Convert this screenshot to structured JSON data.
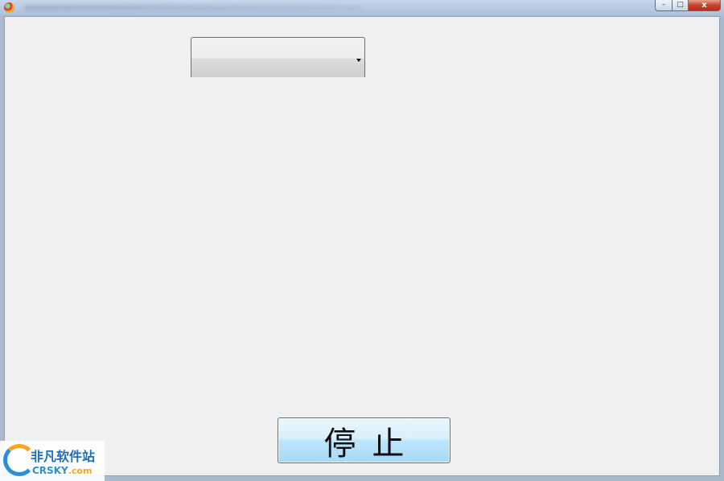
{
  "window": {
    "controls": {
      "minimize_symbol": "–",
      "maximize_symbol": "□",
      "close_symbol": "x"
    }
  },
  "main": {
    "combo": {
      "value": ""
    },
    "stop_button": {
      "label": "停止"
    }
  },
  "watermark": {
    "name_cn": "非凡软件站",
    "name_en": "CRSKY",
    "domain_suffix": ".com"
  },
  "colors": {
    "button_border": "#3c7fb1",
    "button_fill": "#bee6fd",
    "client_bg": "#f0f0f0",
    "close_button": "#c7432c"
  }
}
